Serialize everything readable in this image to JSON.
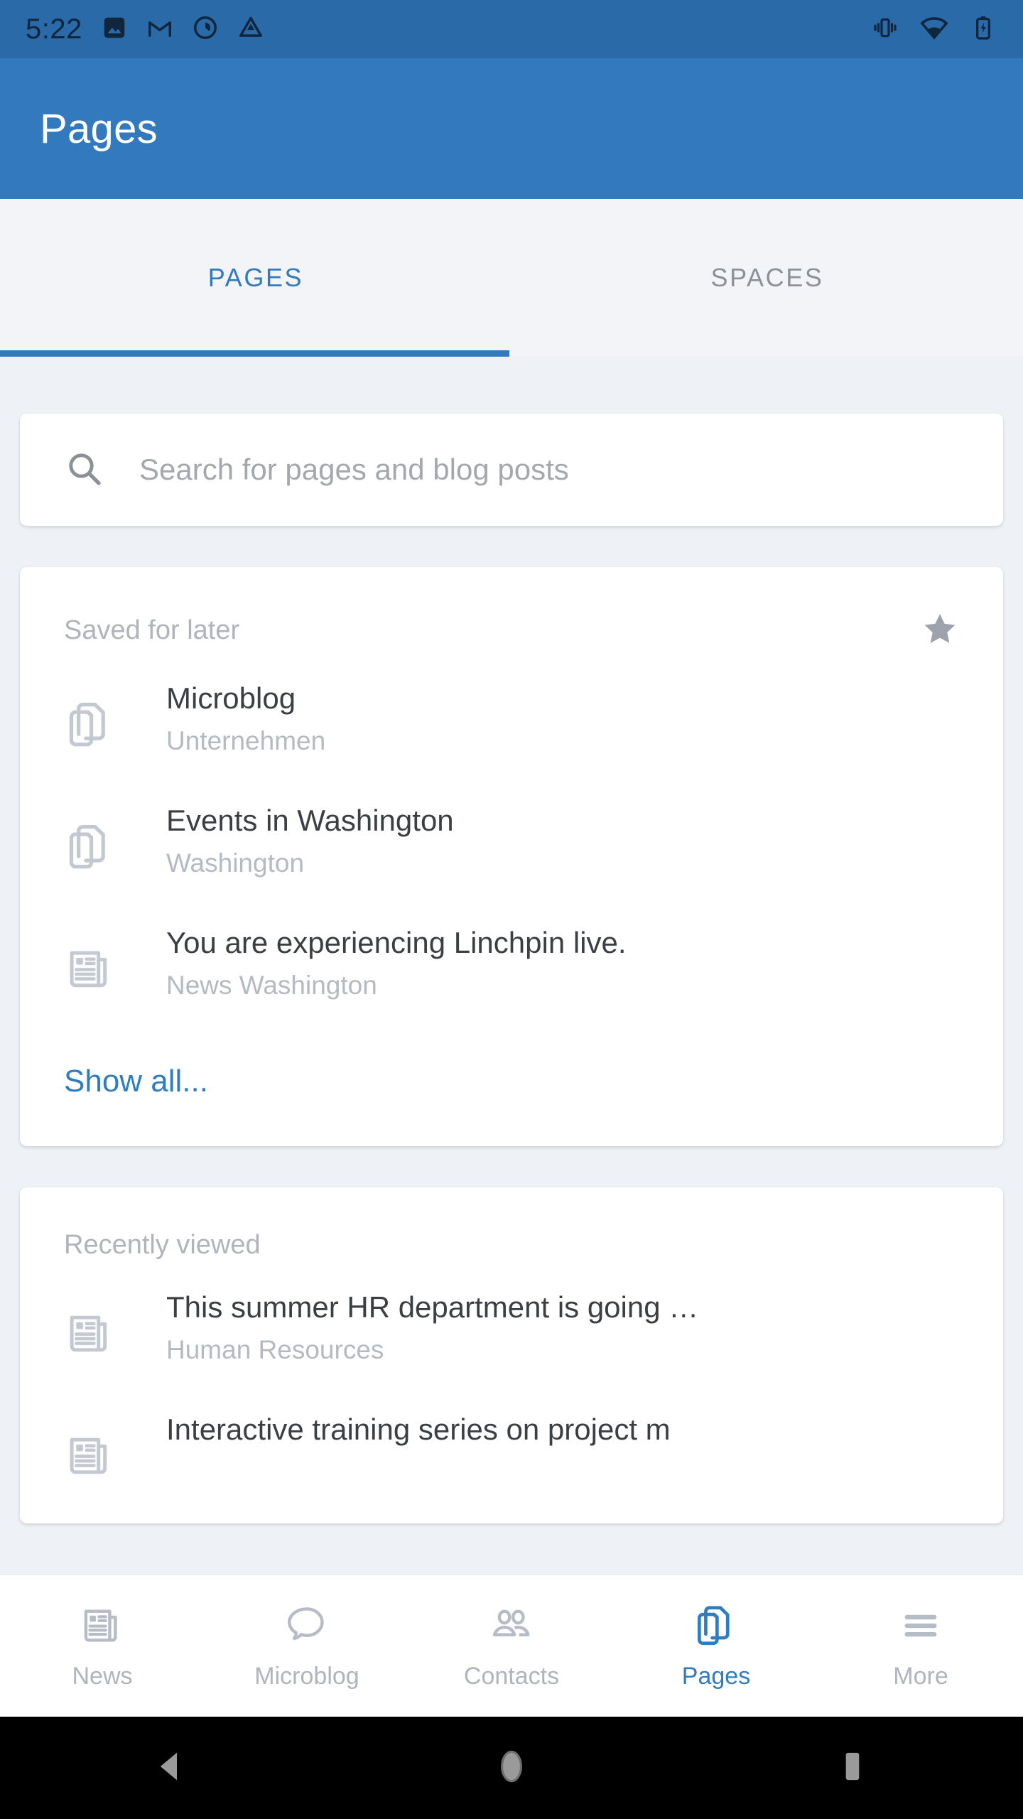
{
  "status_bar": {
    "time": "5:22",
    "left_icons": [
      "photos-icon",
      "gmail-icon",
      "qustodio-icon",
      "drive-icon"
    ],
    "right_icons": [
      "vibrate-icon",
      "wifi-icon",
      "battery-charging-icon"
    ],
    "background_color": "#2a6aa8"
  },
  "app_bar": {
    "title": "Pages",
    "background_color": "#3279bd",
    "text_color": "#ffffff"
  },
  "tabs": {
    "items": [
      {
        "label": "PAGES",
        "active": true
      },
      {
        "label": "SPACES",
        "active": false
      }
    ],
    "active_color": "#3279bd",
    "inactive_color": "#8d9196"
  },
  "search": {
    "placeholder": "Search for pages and blog posts",
    "icon": "search-icon",
    "value": ""
  },
  "sections": [
    {
      "title": "Saved for later",
      "action_icon": "star-filled-icon",
      "items": [
        {
          "icon": "pages-copy-icon",
          "title": "Microblog",
          "subtitle": "Unternehmen"
        },
        {
          "icon": "pages-copy-icon",
          "title": "Events in Washington",
          "subtitle": "Washington"
        },
        {
          "icon": "news-paper-icon",
          "title": "You are experiencing Linchpin live.",
          "subtitle": "News Washington"
        }
      ],
      "footer_link": "Show all..."
    },
    {
      "title": "Recently viewed",
      "action_icon": null,
      "items": [
        {
          "icon": "news-paper-icon",
          "title": "This summer HR department is going …",
          "subtitle": "Human Resources"
        },
        {
          "icon": "news-paper-icon",
          "title": "Interactive training series on project m",
          "subtitle": ""
        }
      ],
      "footer_link": null
    }
  ],
  "bottom_nav": {
    "items": [
      {
        "label": "News",
        "icon": "news-paper-icon",
        "active": false
      },
      {
        "label": "Microblog",
        "icon": "speech-bubble-icon",
        "active": false
      },
      {
        "label": "Contacts",
        "icon": "people-icon",
        "active": false
      },
      {
        "label": "Pages",
        "icon": "pages-copy-icon",
        "active": true
      },
      {
        "label": "More",
        "icon": "hamburger-icon",
        "active": false
      }
    ],
    "active_color": "#2f7cc0",
    "inactive_color": "#b0b4bd"
  },
  "android_nav": {
    "buttons": [
      "back-icon",
      "home-icon",
      "recents-icon"
    ],
    "background_color": "#000000"
  },
  "colors": {
    "page_background": "#eef1f5",
    "card_background": "#ffffff",
    "link_blue": "#2f7cc0",
    "muted_text": "#b0b4ba"
  }
}
